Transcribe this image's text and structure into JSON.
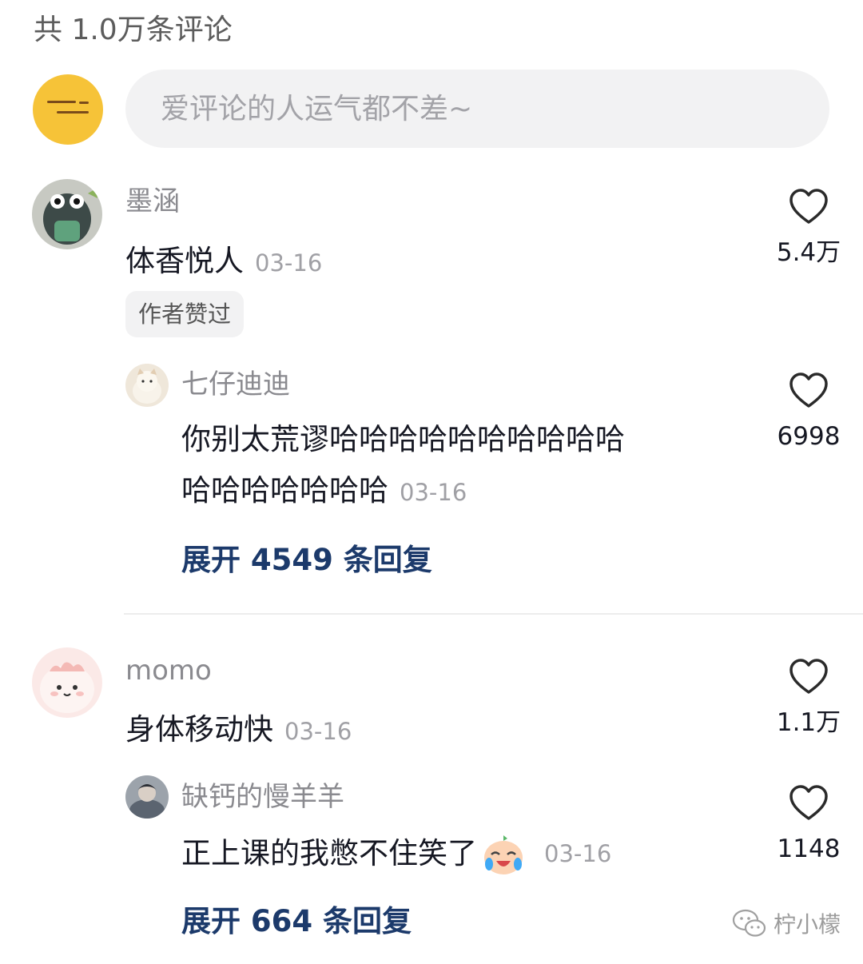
{
  "header": {
    "comment_count": "共 1.0万条评论"
  },
  "input": {
    "placeholder": "爱评论的人运气都不差~"
  },
  "comments": [
    {
      "user": "墨涵",
      "text": "体香悦人",
      "date": "03-16",
      "likes": "5.4万",
      "badge": "作者赞过",
      "reply": {
        "user": "七仔迪迪",
        "text_line1": "你别太荒谬哈哈哈哈哈哈哈哈哈哈",
        "text_line2": "哈哈哈哈哈哈哈",
        "date": "03-16",
        "likes": "6998"
      },
      "expand": "展开 4549 条回复"
    },
    {
      "user": "momo",
      "text": "身体移动快",
      "date": "03-16",
      "likes": "1.1万",
      "reply": {
        "user": "缺钙的慢羊羊",
        "text": "正上课的我憋不住笑了",
        "date": "03-16",
        "likes": "1148"
      },
      "expand": "展开 664 条回复"
    }
  ],
  "watermark": {
    "text": "柠小檬"
  },
  "colors": {
    "expand_link": "#1c3a6b",
    "my_avatar_bg": "#f6c338",
    "input_bg": "#f2f2f3"
  },
  "icons": [
    "heart-outline-icon",
    "wechat-logo-icon",
    "crying-laugh-emoji"
  ]
}
